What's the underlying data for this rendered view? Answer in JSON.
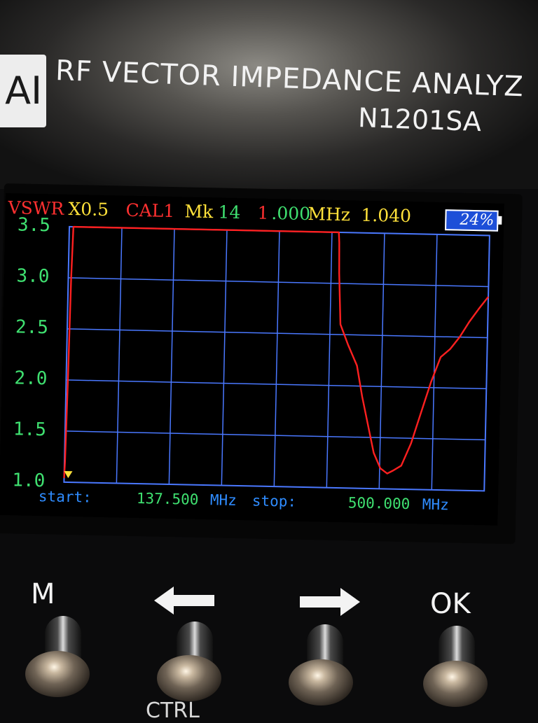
{
  "device": {
    "logo_text": "AI",
    "title": "RF VECTOR IMPEDANCE ANALYZ",
    "model": "N1201SA"
  },
  "status_bar": {
    "mode": "VSWR",
    "scale": "X0.5",
    "calibration": "CAL1",
    "marker_label": "Mk",
    "marker_freq_part1": "14",
    "marker_freq_part2": "1",
    "marker_freq_part3": ".000",
    "marker_unit": "MHz",
    "marker_value": "1.040",
    "battery": "24%"
  },
  "y_axis": {
    "ticks": [
      "3.5",
      "3.0",
      "2.5",
      "2.0",
      "1.5",
      "1.0"
    ]
  },
  "footer": {
    "start_label": "start:",
    "start_value": "137.500",
    "start_unit": "MHz",
    "stop_label": "stop:",
    "stop_value": "500.000",
    "stop_unit": "MHz"
  },
  "buttons": {
    "m_label": "M",
    "ok_label": "OK",
    "ctrl_label": "CTRL"
  },
  "colors": {
    "trace": "#ff2020",
    "grid": "#4a78ff",
    "tick": "#3fe070",
    "marker": "#ffe13a"
  },
  "chart_data": {
    "type": "line",
    "title": "",
    "xlabel": "",
    "ylabel": "VSWR",
    "x_range_mhz": [
      137.5,
      500.0
    ],
    "ylim": [
      1.0,
      3.5
    ],
    "grid": true,
    "series": [
      {
        "name": "VSWR",
        "x": [
          137.5,
          138.0,
          139.0,
          140.0,
          141.0,
          142.0,
          145.0,
          200.0,
          280.0,
          370.0,
          370.5,
          371.0,
          373.0,
          380.0,
          388.0,
          393.0,
          399.0,
          404.0,
          410.0,
          416.0,
          421.0,
          428.0,
          436.0,
          444.0,
          452.0,
          460.0,
          468.0,
          476.0,
          484.0,
          492.0,
          500.0
        ],
        "y": [
          1.04,
          1.2,
          2.0,
          3.0,
          3.5,
          3.5,
          3.5,
          3.5,
          3.5,
          3.5,
          3.4,
          3.1,
          2.6,
          2.4,
          2.2,
          1.9,
          1.6,
          1.35,
          1.2,
          1.15,
          1.18,
          1.23,
          1.45,
          1.75,
          2.05,
          2.3,
          2.38,
          2.5,
          2.65,
          2.78,
          2.9
        ]
      }
    ],
    "marker": {
      "x": 141.0,
      "y": 1.04
    }
  }
}
